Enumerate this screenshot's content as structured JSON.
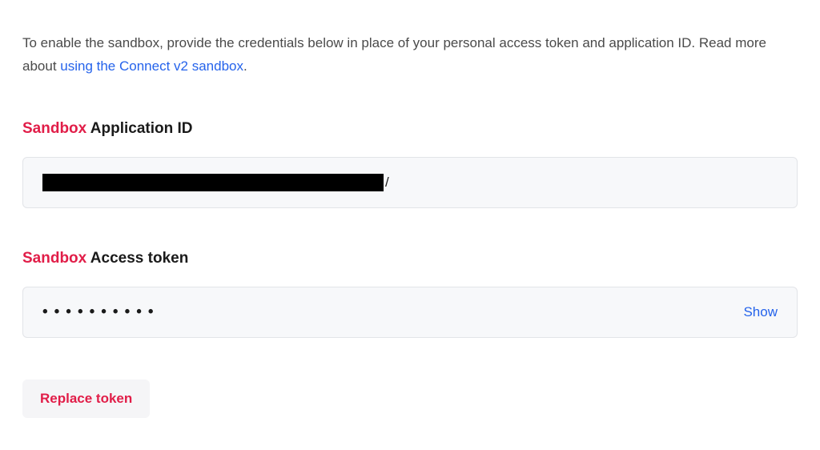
{
  "intro": {
    "text_before_link": "To enable the sandbox, provide the credentials below in place of your personal access token and application ID. Read more about ",
    "link_text": "using the Connect v2 sandbox",
    "text_after_link": "."
  },
  "fields": {
    "app_id": {
      "sandbox_prefix": "Sandbox",
      "label_rest": " Application ID",
      "value_tail": "/"
    },
    "access_token": {
      "sandbox_prefix": "Sandbox",
      "label_rest": " Access token",
      "masked_value": "••••••••••",
      "show_label": "Show"
    }
  },
  "actions": {
    "replace_token_label": "Replace token"
  }
}
